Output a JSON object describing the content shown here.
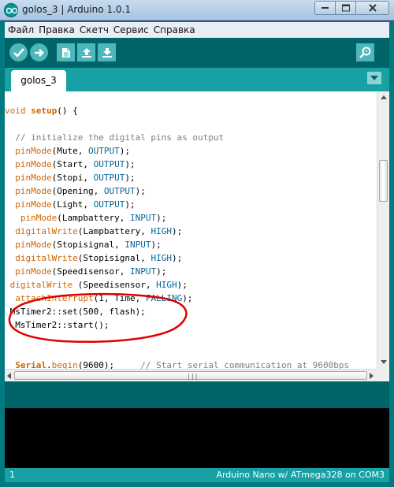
{
  "window": {
    "title": "golos_3 | Arduino 1.0.1"
  },
  "menu": {
    "items": [
      "Файл",
      "Правка",
      "Скетч",
      "Сервис",
      "Справка"
    ]
  },
  "toolbar": {
    "buttons": [
      "verify-icon",
      "upload-icon",
      "new-icon",
      "open-icon",
      "save-icon"
    ],
    "right_button": "serial-monitor-icon"
  },
  "tabs": [
    {
      "label": "golos_3"
    }
  ],
  "editor": {
    "lines": [
      "void setup() {",
      "",
      "  // initialize the digital pins as output",
      "  pinMode(Mute, OUTPUT);",
      "  pinMode(Start, OUTPUT);",
      "  pinMode(Stopi, OUTPUT);",
      "  pinMode(Opening, OUTPUT);",
      "  pinMode(Light, OUTPUT);",
      "   pinMode(Lampbattery, INPUT);",
      "  digitalWrite(Lampbattery, HIGH);",
      "  pinMode(Stopisignal, INPUT);",
      "  digitalWrite(Stopisignal, HIGH);",
      "  pinMode(Speedisensor, INPUT);",
      " digitalWrite (Speedisensor, HIGH);",
      "  attachInterrupt(1, Time, FALLING);",
      " MsTimer2::set(500, flash);",
      "  MsTimer2::start();",
      "",
      "",
      "  Serial.begin(9600);     // Start serial communication at 9600bps"
    ]
  },
  "status": {
    "line_number": "1",
    "board": "Arduino Nano w/ ATmega328 on COM3"
  },
  "colors": {
    "teal_dark": "#006468",
    "teal_mid": "#17a1a5",
    "keyword": "#cc6600",
    "constant": "#006699",
    "comment": "#7e7e7e",
    "annotation": "#e00000"
  }
}
